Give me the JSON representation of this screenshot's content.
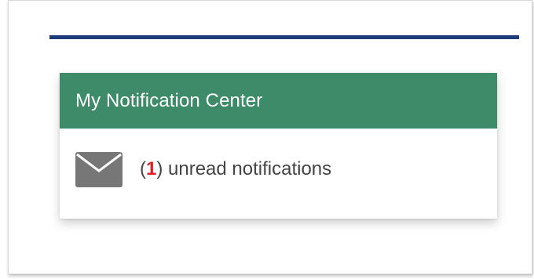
{
  "notification_center": {
    "title": "My Notification Center",
    "open_paren": "(",
    "unread_count": "1",
    "close_text": ") unread notifications"
  },
  "icons": {
    "mail": "envelope-icon"
  },
  "colors": {
    "header_bg": "#3d8b68",
    "top_rule": "#1f3c7a",
    "count_red": "#e02020",
    "text_gray": "#444444",
    "icon_gray": "#777777"
  }
}
